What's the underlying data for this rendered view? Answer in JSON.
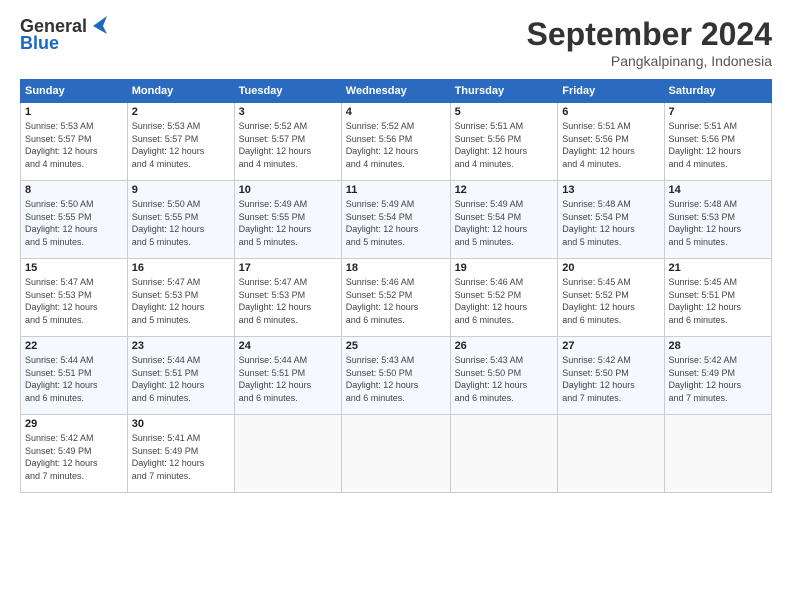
{
  "header": {
    "logo_general": "General",
    "logo_blue": "Blue",
    "month_title": "September 2024",
    "subtitle": "Pangkalpinang, Indonesia"
  },
  "days_of_week": [
    "Sunday",
    "Monday",
    "Tuesday",
    "Wednesday",
    "Thursday",
    "Friday",
    "Saturday"
  ],
  "weeks": [
    [
      {
        "day": "1",
        "sunrise": "5:53 AM",
        "sunset": "5:57 PM",
        "daylight": "12 hours and 4 minutes."
      },
      {
        "day": "2",
        "sunrise": "5:53 AM",
        "sunset": "5:57 PM",
        "daylight": "12 hours and 4 minutes."
      },
      {
        "day": "3",
        "sunrise": "5:52 AM",
        "sunset": "5:57 PM",
        "daylight": "12 hours and 4 minutes."
      },
      {
        "day": "4",
        "sunrise": "5:52 AM",
        "sunset": "5:56 PM",
        "daylight": "12 hours and 4 minutes."
      },
      {
        "day": "5",
        "sunrise": "5:51 AM",
        "sunset": "5:56 PM",
        "daylight": "12 hours and 4 minutes."
      },
      {
        "day": "6",
        "sunrise": "5:51 AM",
        "sunset": "5:56 PM",
        "daylight": "12 hours and 4 minutes."
      },
      {
        "day": "7",
        "sunrise": "5:51 AM",
        "sunset": "5:56 PM",
        "daylight": "12 hours and 4 minutes."
      }
    ],
    [
      {
        "day": "8",
        "sunrise": "5:50 AM",
        "sunset": "5:55 PM",
        "daylight": "12 hours and 5 minutes."
      },
      {
        "day": "9",
        "sunrise": "5:50 AM",
        "sunset": "5:55 PM",
        "daylight": "12 hours and 5 minutes."
      },
      {
        "day": "10",
        "sunrise": "5:49 AM",
        "sunset": "5:55 PM",
        "daylight": "12 hours and 5 minutes."
      },
      {
        "day": "11",
        "sunrise": "5:49 AM",
        "sunset": "5:54 PM",
        "daylight": "12 hours and 5 minutes."
      },
      {
        "day": "12",
        "sunrise": "5:49 AM",
        "sunset": "5:54 PM",
        "daylight": "12 hours and 5 minutes."
      },
      {
        "day": "13",
        "sunrise": "5:48 AM",
        "sunset": "5:54 PM",
        "daylight": "12 hours and 5 minutes."
      },
      {
        "day": "14",
        "sunrise": "5:48 AM",
        "sunset": "5:53 PM",
        "daylight": "12 hours and 5 minutes."
      }
    ],
    [
      {
        "day": "15",
        "sunrise": "5:47 AM",
        "sunset": "5:53 PM",
        "daylight": "12 hours and 5 minutes."
      },
      {
        "day": "16",
        "sunrise": "5:47 AM",
        "sunset": "5:53 PM",
        "daylight": "12 hours and 5 minutes."
      },
      {
        "day": "17",
        "sunrise": "5:47 AM",
        "sunset": "5:53 PM",
        "daylight": "12 hours and 6 minutes."
      },
      {
        "day": "18",
        "sunrise": "5:46 AM",
        "sunset": "5:52 PM",
        "daylight": "12 hours and 6 minutes."
      },
      {
        "day": "19",
        "sunrise": "5:46 AM",
        "sunset": "5:52 PM",
        "daylight": "12 hours and 6 minutes."
      },
      {
        "day": "20",
        "sunrise": "5:45 AM",
        "sunset": "5:52 PM",
        "daylight": "12 hours and 6 minutes."
      },
      {
        "day": "21",
        "sunrise": "5:45 AM",
        "sunset": "5:51 PM",
        "daylight": "12 hours and 6 minutes."
      }
    ],
    [
      {
        "day": "22",
        "sunrise": "5:44 AM",
        "sunset": "5:51 PM",
        "daylight": "12 hours and 6 minutes."
      },
      {
        "day": "23",
        "sunrise": "5:44 AM",
        "sunset": "5:51 PM",
        "daylight": "12 hours and 6 minutes."
      },
      {
        "day": "24",
        "sunrise": "5:44 AM",
        "sunset": "5:51 PM",
        "daylight": "12 hours and 6 minutes."
      },
      {
        "day": "25",
        "sunrise": "5:43 AM",
        "sunset": "5:50 PM",
        "daylight": "12 hours and 6 minutes."
      },
      {
        "day": "26",
        "sunrise": "5:43 AM",
        "sunset": "5:50 PM",
        "daylight": "12 hours and 6 minutes."
      },
      {
        "day": "27",
        "sunrise": "5:42 AM",
        "sunset": "5:50 PM",
        "daylight": "12 hours and 7 minutes."
      },
      {
        "day": "28",
        "sunrise": "5:42 AM",
        "sunset": "5:49 PM",
        "daylight": "12 hours and 7 minutes."
      }
    ],
    [
      {
        "day": "29",
        "sunrise": "5:42 AM",
        "sunset": "5:49 PM",
        "daylight": "12 hours and 7 minutes."
      },
      {
        "day": "30",
        "sunrise": "5:41 AM",
        "sunset": "5:49 PM",
        "daylight": "12 hours and 7 minutes."
      },
      null,
      null,
      null,
      null,
      null
    ]
  ],
  "labels": {
    "sunrise_prefix": "Sunrise: ",
    "sunset_prefix": "Sunset: ",
    "daylight_prefix": "Daylight: "
  }
}
